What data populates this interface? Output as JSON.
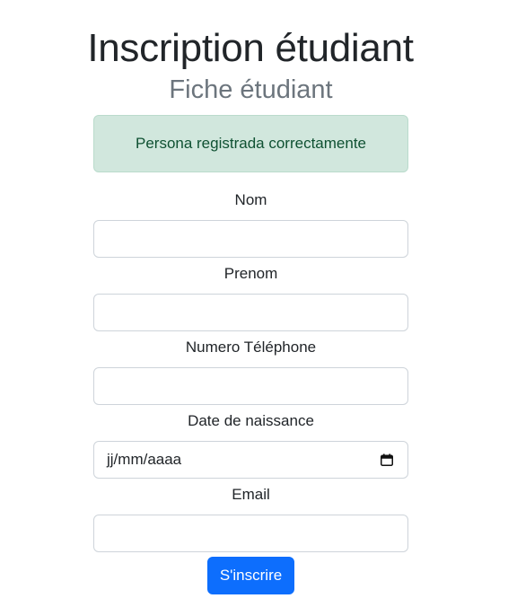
{
  "page": {
    "title": "Inscription étudiant"
  },
  "form": {
    "title": "Fiche étudiant",
    "alert": "Persona registrada correctamente",
    "fields": [
      {
        "label": "Nom",
        "value": "",
        "type": "text"
      },
      {
        "label": "Prenom",
        "value": "",
        "type": "text"
      },
      {
        "label": "Numero Téléphone",
        "value": "",
        "type": "tel"
      },
      {
        "label": "Date de naissance",
        "value": "",
        "placeholder": "jj/mm/aaaa",
        "type": "date",
        "icon": "calendar-icon"
      },
      {
        "label": "Email",
        "value": "",
        "type": "email"
      }
    ],
    "submit_label": "S'inscrire"
  },
  "colors": {
    "primary": "#0d6efd",
    "alert_bg": "#d1e7dd",
    "alert_text": "#0f5132",
    "muted": "#6c757d",
    "text": "#212529"
  }
}
